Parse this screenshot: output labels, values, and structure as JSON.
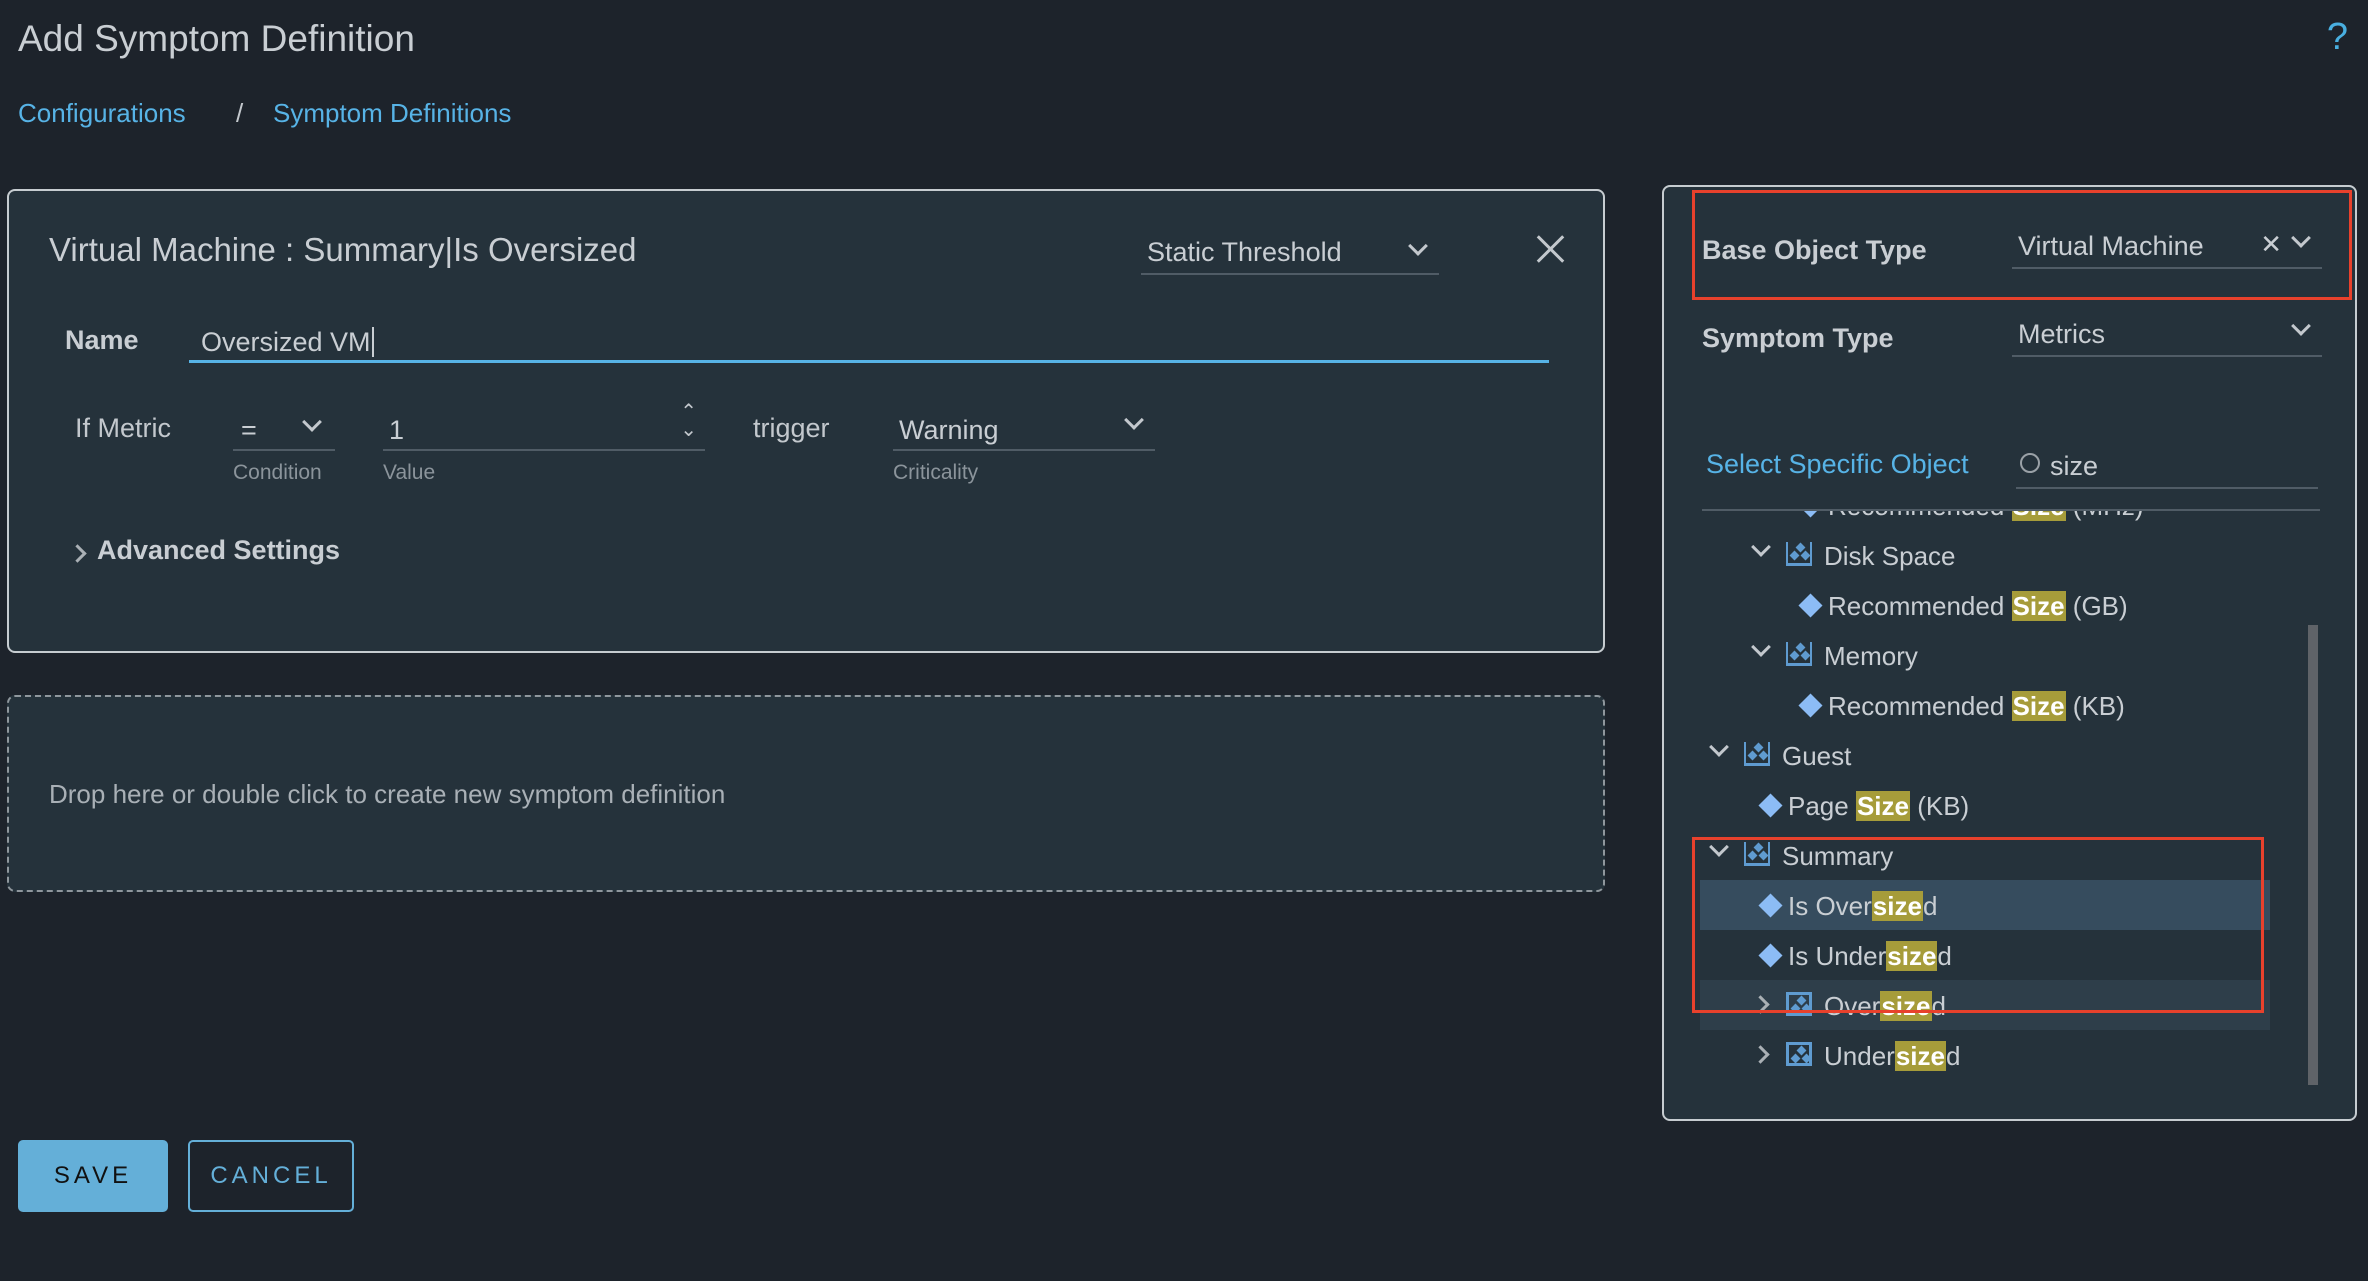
{
  "page": {
    "title": "Add Symptom Definition",
    "help": "?"
  },
  "breadcrumb": [
    "Configurations",
    "Symptom Definitions"
  ],
  "breadcrumb_sep": "/",
  "card": {
    "title": "Virtual Machine : Summary|Is Oversized",
    "threshold": "Static Threshold",
    "name_label": "Name",
    "name_value": "Oversized VM",
    "if_metric": "If Metric",
    "condition": "=",
    "condition_label": "Condition",
    "value": "1",
    "value_label": "Value",
    "trigger": "trigger",
    "criticality": "Warning",
    "criticality_label": "Criticality",
    "advanced": "Advanced Settings"
  },
  "dropzone": "Drop here or double click to create new symptom definition",
  "right": {
    "base_label": "Base Object Type",
    "base_value": "Virtual Machine",
    "type_label": "Symptom Type",
    "type_value": "Metrics",
    "select_specific": "Select Specific Object",
    "search": "size",
    "tree": [
      {
        "kind": "leaf",
        "level": 3,
        "pre": "Recommended ",
        "m": "Size",
        "post": " (MHz)"
      },
      {
        "kind": "group",
        "level": 2,
        "pre": "Disk Space",
        "m": "",
        "post": "",
        "open": true
      },
      {
        "kind": "leaf",
        "level": 3,
        "pre": "Recommended ",
        "m": "Size",
        "post": " (GB)"
      },
      {
        "kind": "group",
        "level": 2,
        "pre": "Memory",
        "m": "",
        "post": "",
        "open": true
      },
      {
        "kind": "leaf",
        "level": 3,
        "pre": "Recommended ",
        "m": "Size",
        "post": " (KB)"
      },
      {
        "kind": "group",
        "level": 1,
        "pre": "Guest",
        "m": "",
        "post": "",
        "open": true
      },
      {
        "kind": "leaf",
        "level": 2,
        "pre": "Page ",
        "m": "Size",
        "post": " (KB)"
      },
      {
        "kind": "group",
        "level": 1,
        "pre": "Summary",
        "m": "",
        "post": "",
        "open": true
      },
      {
        "kind": "leaf",
        "level": 2,
        "pre": "Is Over",
        "m": "size",
        "post": "d",
        "selected": true
      },
      {
        "kind": "leaf",
        "level": 2,
        "pre": "Is Under",
        "m": "size",
        "post": "d"
      },
      {
        "kind": "group",
        "level": 2,
        "pre": "Over",
        "m": "size",
        "post": "d",
        "open": false,
        "hover": true
      },
      {
        "kind": "group",
        "level": 2,
        "pre": "Under",
        "m": "size",
        "post": "d",
        "open": false
      }
    ]
  },
  "buttons": {
    "save": "SAVE",
    "cancel": "CANCEL"
  },
  "colors": {
    "accent": "#57b3e6",
    "highlight": "#a69c3a",
    "annotation": "#e8412c",
    "selected_row": "#364c5e"
  }
}
